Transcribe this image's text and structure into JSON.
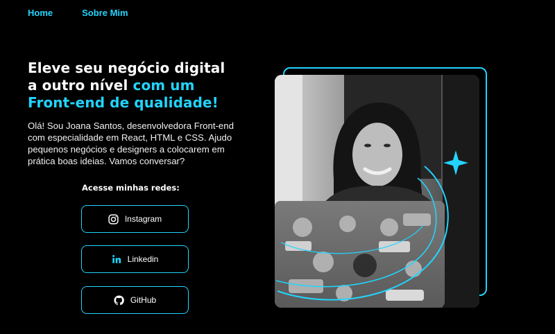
{
  "nav": {
    "items": [
      "Home",
      "Sobre Mim"
    ]
  },
  "hero": {
    "title_line1": "Eleve seu negócio digital",
    "title_line2_white": "a outro nível ",
    "title_line2_accent": "com um",
    "title_line3_accent": "Front-end de qualidade!",
    "intro": "Olá! Sou Joana Santos, desenvolvedora Front-end com especialidade em React, HTML e CSS. Ajudo pequenos negócios e designers a colocarem em prática boas ideias. Vamos conversar?"
  },
  "social": {
    "heading": "Acesse minhas redes:",
    "buttons": [
      {
        "label": "Instagram",
        "icon": "instagram-icon"
      },
      {
        "label": "Linkedin",
        "icon": "linkedin-icon"
      },
      {
        "label": "GitHub",
        "icon": "github-icon"
      }
    ]
  },
  "colors": {
    "background": "#000000",
    "accent": "#22d4fd",
    "text": "#ffffff"
  }
}
